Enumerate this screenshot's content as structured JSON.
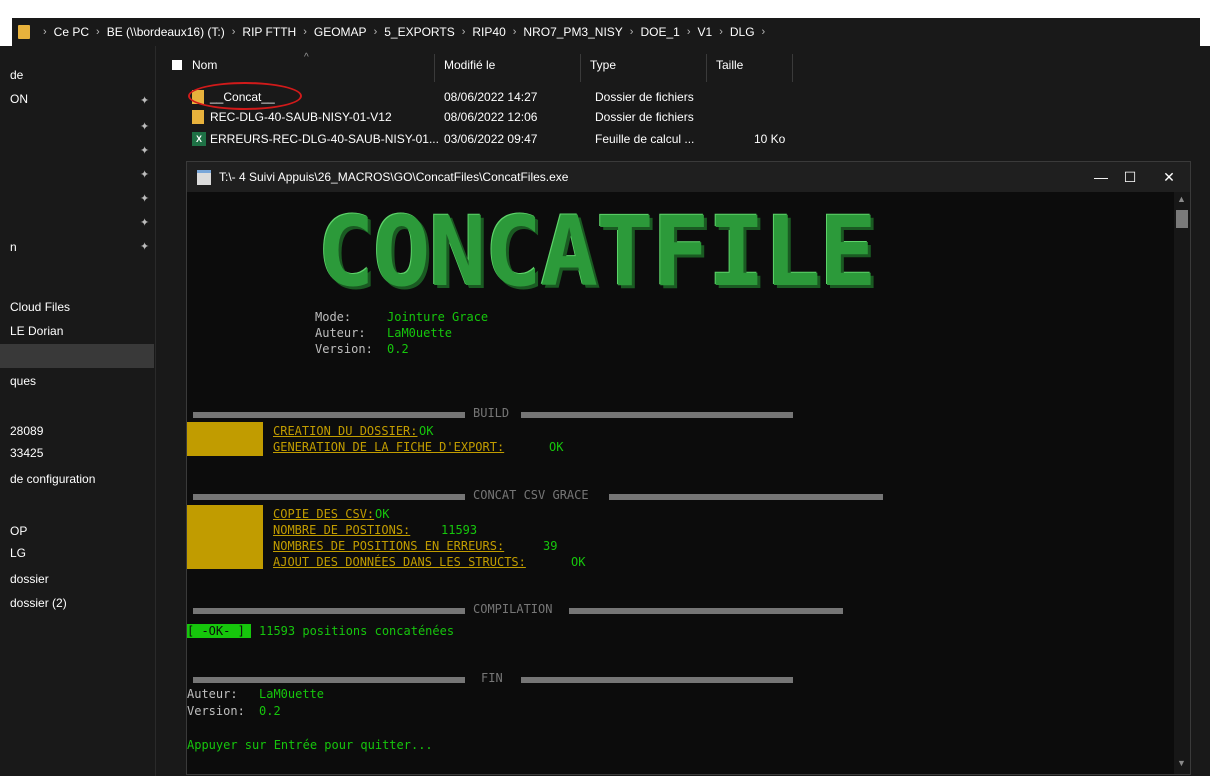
{
  "breadcrumb": {
    "items": [
      "Ce PC",
      "BE (\\\\bordeaux16) (T:)",
      "RIP FTTH",
      "GEOMAP",
      "5_EXPORTS",
      "RIP40",
      "NRO7_PM3_NISY",
      "DOE_1",
      "V1",
      "DLG"
    ]
  },
  "nav": {
    "items": [
      "de",
      "ON",
      "",
      "",
      "",
      "",
      "",
      "n",
      "Cloud Files",
      "LE Dorian",
      "",
      "ques",
      "28089",
      "33425",
      "de configuration",
      "OP",
      "LG",
      "dossier",
      "dossier (2)"
    ]
  },
  "columns": {
    "name": "Nom",
    "modified": "Modifié le",
    "type": "Type",
    "size": "Taille"
  },
  "files": [
    {
      "name": "__Concat__",
      "modified": "08/06/2022 14:27",
      "type": "Dossier de fichiers",
      "size": "",
      "icon": "folder-icon"
    },
    {
      "name": "REC-DLG-40-SAUB-NISY-01-V12",
      "modified": "08/06/2022 12:06",
      "type": "Dossier de fichiers",
      "size": "",
      "icon": "folder-icon"
    },
    {
      "name": "ERREURS-REC-DLG-40-SAUB-NISY-01...",
      "modified": "03/06/2022 09:47",
      "type": "Feuille de calcul ...",
      "size": "10 Ko",
      "icon": "excel-icon"
    }
  ],
  "console": {
    "title": "T:\\- 4 Suivi Appuis\\26_MACROS\\GO\\ConcatFiles\\ConcatFiles.exe",
    "banner": "CONCATFILE",
    "mode_label": "Mode:",
    "mode_value": "Jointure Grace",
    "author_label": "Auteur:",
    "author_value": "LaM0uette",
    "version_label": "Version:",
    "version_value": "0.2",
    "build_label": "BUILD",
    "build_lines": [
      {
        "label": "CREATION DU DOSSIER:",
        "value": "OK"
      },
      {
        "label": "GENERATION DE LA FICHE D'EXPORT:",
        "value": "OK"
      }
    ],
    "concat_label": "CONCAT CSV GRACE",
    "concat_lines": [
      {
        "label": "COPIE DES CSV:",
        "value": "OK"
      },
      {
        "label": "NOMBRE DE POSTIONS:",
        "value": "11593"
      },
      {
        "label": "NOMBRES DE POSITIONS EN ERREURS:",
        "value": "39"
      },
      {
        "label": "AJOUT DES DONNÉES DANS LES STRUCTS:",
        "value": "OK"
      }
    ],
    "compilation_label": "COMPILATION",
    "ok_badge": "[ -OK- ]",
    "ok_message": "11593 positions concaténées",
    "fin_label": "FIN",
    "footer_author_label": "Auteur:",
    "footer_author_value": "LaM0uette",
    "footer_version_label": "Version:",
    "footer_version_value": "0.2",
    "exit_prompt": "Appuyer sur Entrée pour quitter...",
    "colors": {
      "green": "#16c60c",
      "yellow": "#c19c00",
      "gray": "#767676",
      "banner": "#2c9a3a"
    }
  }
}
